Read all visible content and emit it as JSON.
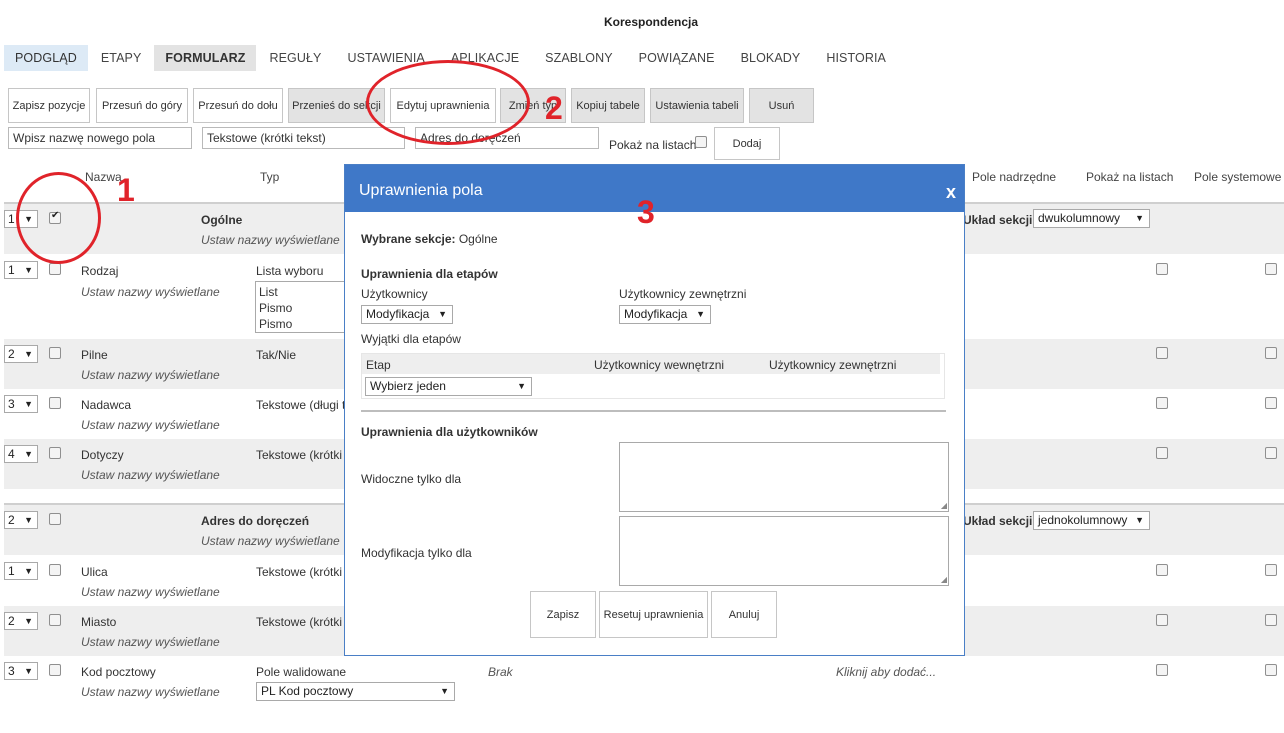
{
  "page": {
    "title": "Korespondencja"
  },
  "tabs": [
    "PODGLĄD",
    "ETAPY",
    "FORMULARZ",
    "REGUŁY",
    "USTAWIENIA",
    "APLIKACJE",
    "SZABLONY",
    "POWIĄZANE",
    "BLOKADY",
    "HISTORIA"
  ],
  "toolbar": [
    "Zapisz pozycje",
    "Przesuń do góry",
    "Przesuń do dołu",
    "Przenieś do sekcji",
    "Edytuj uprawnienia",
    "Zmień typ",
    "Kopiuj tabele",
    "Ustawienia tabeli",
    "Usuń"
  ],
  "add_field": {
    "name_placeholder": "Wpisz nazwę nowego pola",
    "type_value": "Tekstowe (krótki tekst)",
    "section_value": "Adres do doręczeń",
    "show_on_lists_label": "Pokaż na listach",
    "add_button": "Dodaj"
  },
  "table_headers": {
    "name": "Nazwa",
    "type": "Typ",
    "parent_field": "Pole nadrzędne",
    "show_on_lists": "Pokaż na listach",
    "system_field": "Pole systemowe"
  },
  "sections": [
    {
      "order": "1",
      "name": "Ogólne",
      "display_names": "Ustaw nazwy wyświetlane",
      "layout_label": "Układ sekcji:",
      "layout_value": "dwukolumnowy",
      "fields": [
        {
          "order": "1",
          "name": "Rodzaj",
          "display_names": "Ustaw nazwy wyświetlane",
          "type": "Lista wyboru",
          "options": [
            "List",
            "Pismo",
            "Pismo urzędowe"
          ]
        },
        {
          "order": "2",
          "name": "Pilne",
          "display_names": "Ustaw nazwy wyświetlane",
          "type": "Tak/Nie"
        },
        {
          "order": "3",
          "name": "Nadawca",
          "display_names": "Ustaw nazwy wyświetlane",
          "type": "Tekstowe (długi t"
        },
        {
          "order": "4",
          "name": "Dotyczy",
          "display_names": "Ustaw nazwy wyświetlane",
          "type": "Tekstowe (krótki"
        }
      ]
    },
    {
      "order": "2",
      "name": "Adres do doręczeń",
      "display_names": "Ustaw nazwy wyświetlane",
      "layout_label": "Układ sekcji:",
      "layout_value": "jednokolumnowy",
      "fields": [
        {
          "order": "1",
          "name": "Ulica",
          "display_names": "Ustaw nazwy wyświetlane",
          "type": "Tekstowe (krótki"
        },
        {
          "order": "2",
          "name": "Miasto",
          "display_names": "Ustaw nazwy wyświetlane",
          "type": "Tekstowe (krótki"
        },
        {
          "order": "3",
          "name": "Kod pocztowy",
          "display_names": "Ustaw nazwy wyświetlane",
          "type": "Pole walidowane",
          "validator": "PL Kod pocztowy",
          "parent": "Brak",
          "click_to_add": "Kliknij aby dodać..."
        }
      ]
    }
  ],
  "annotations": [
    "1",
    "2",
    "3"
  ],
  "modal": {
    "title": "Uprawnienia pola",
    "close": "x",
    "selected_sections_label": "Wybrane sekcje:",
    "selected_sections_value": "Ogólne",
    "stage_permissions_heading": "Uprawnienia dla etapów",
    "users_label": "Użytkownicy",
    "users_value": "Modyfikacja",
    "external_users_label": "Użytkownicy zewnętrzni",
    "external_users_value": "Modyfikacja",
    "exceptions_label": "Wyjątki dla etapów",
    "exceptions_headers": [
      "Etap",
      "Użytkownicy wewnętrzni",
      "Użytkownicy zewnętrzni"
    ],
    "stage_select": "Wybierz jeden",
    "user_permissions_heading": "Uprawnienia dla użytkowników",
    "visible_only_for": "Widoczne tylko dla",
    "modify_only_for": "Modyfikacja tylko dla",
    "buttons": [
      "Zapisz",
      "Resetuj uprawnienia",
      "Anuluj"
    ]
  },
  "colors": {
    "modal_header": "#3f78c8",
    "annotation_red": "#e0232a",
    "tab_active": "#ddeaf6"
  }
}
